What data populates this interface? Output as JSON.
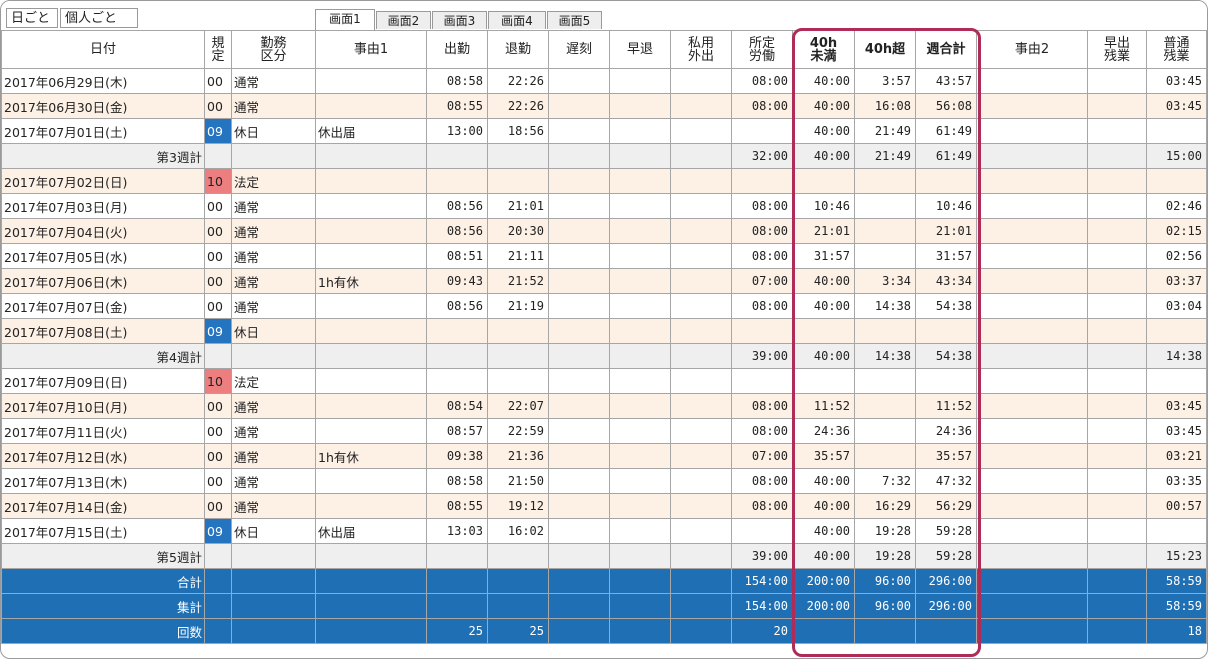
{
  "mode_tabs": [
    "日ごと",
    "個人ごと"
  ],
  "screen_tabs": [
    "画面1",
    "画面2",
    "画面3",
    "画面4",
    "画面5"
  ],
  "columns": [
    {
      "label": [
        "日付"
      ]
    },
    {
      "label": [
        "規",
        "定"
      ]
    },
    {
      "label": [
        "勤務",
        "区分"
      ]
    },
    {
      "label": [
        "事由1"
      ]
    },
    {
      "label": [
        "出勤"
      ]
    },
    {
      "label": [
        "退勤"
      ]
    },
    {
      "label": [
        "遅刻"
      ]
    },
    {
      "label": [
        "早退"
      ]
    },
    {
      "label": [
        "私用",
        "外出"
      ]
    },
    {
      "label": [
        "所定",
        "労働"
      ]
    },
    {
      "label": [
        "40h",
        "未満"
      ],
      "bold": true
    },
    {
      "label": [
        "40h超"
      ],
      "bold": true
    },
    {
      "label": [
        "週合計"
      ],
      "bold": true
    },
    {
      "label": [
        "事由2"
      ]
    },
    {
      "label": [
        "早出",
        "残業"
      ]
    },
    {
      "label": [
        "普通",
        "残業"
      ]
    }
  ],
  "rows": [
    {
      "kind": "day",
      "date": "2017年06月29日(木)",
      "code": "00",
      "type": "通常",
      "reason1": "",
      "in": "08:58",
      "out": "22:26",
      "late": "",
      "early": "",
      "private": "",
      "sched": "08:00",
      "u40": "40:00",
      "o40": "3:57",
      "week": "43:57",
      "reason2": "",
      "hayade": "",
      "ot": "03:45"
    },
    {
      "kind": "day",
      "date": "2017年06月30日(金)",
      "code": "00",
      "type": "通常",
      "reason1": "",
      "in": "08:55",
      "out": "22:26",
      "late": "",
      "early": "",
      "private": "",
      "sched": "08:00",
      "u40": "40:00",
      "o40": "16:08",
      "week": "56:08",
      "reason2": "",
      "hayade": "",
      "ot": "03:45"
    },
    {
      "kind": "day",
      "date": "2017年07月01日(土)",
      "code": "09",
      "type": "休日",
      "reason1": "休出届",
      "in": "13:00",
      "out": "18:56",
      "late": "",
      "early": "",
      "private": "",
      "sched": "",
      "u40": "40:00",
      "o40": "21:49",
      "week": "61:49",
      "reason2": "",
      "hayade": "",
      "ot": ""
    },
    {
      "kind": "week",
      "label": "第3週計",
      "sched": "32:00",
      "u40": "40:00",
      "o40": "21:49",
      "week": "61:49",
      "hayade": "",
      "ot": "15:00"
    },
    {
      "kind": "day",
      "date": "2017年07月02日(日)",
      "code": "10",
      "type": "法定",
      "reason1": "",
      "in": "",
      "out": "",
      "late": "",
      "early": "",
      "private": "",
      "sched": "",
      "u40": "",
      "o40": "",
      "week": "",
      "reason2": "",
      "hayade": "",
      "ot": ""
    },
    {
      "kind": "day",
      "date": "2017年07月03日(月)",
      "code": "00",
      "type": "通常",
      "reason1": "",
      "in": "08:56",
      "out": "21:01",
      "late": "",
      "early": "",
      "private": "",
      "sched": "08:00",
      "u40": "10:46",
      "o40": "",
      "week": "10:46",
      "reason2": "",
      "hayade": "",
      "ot": "02:46"
    },
    {
      "kind": "day",
      "date": "2017年07月04日(火)",
      "code": "00",
      "type": "通常",
      "reason1": "",
      "in": "08:56",
      "out": "20:30",
      "late": "",
      "early": "",
      "private": "",
      "sched": "08:00",
      "u40": "21:01",
      "o40": "",
      "week": "21:01",
      "reason2": "",
      "hayade": "",
      "ot": "02:15"
    },
    {
      "kind": "day",
      "date": "2017年07月05日(水)",
      "code": "00",
      "type": "通常",
      "reason1": "",
      "in": "08:51",
      "out": "21:11",
      "late": "",
      "early": "",
      "private": "",
      "sched": "08:00",
      "u40": "31:57",
      "o40": "",
      "week": "31:57",
      "reason2": "",
      "hayade": "",
      "ot": "02:56"
    },
    {
      "kind": "day",
      "date": "2017年07月06日(木)",
      "code": "00",
      "type": "通常",
      "reason1": "1h有休",
      "in": "09:43",
      "out": "21:52",
      "late": "",
      "early": "",
      "private": "",
      "sched": "07:00",
      "u40": "40:00",
      "o40": "3:34",
      "week": "43:34",
      "reason2": "",
      "hayade": "",
      "ot": "03:37"
    },
    {
      "kind": "day",
      "date": "2017年07月07日(金)",
      "code": "00",
      "type": "通常",
      "reason1": "",
      "in": "08:56",
      "out": "21:19",
      "late": "",
      "early": "",
      "private": "",
      "sched": "08:00",
      "u40": "40:00",
      "o40": "14:38",
      "week": "54:38",
      "reason2": "",
      "hayade": "",
      "ot": "03:04"
    },
    {
      "kind": "day",
      "date": "2017年07月08日(土)",
      "code": "09",
      "type": "休日",
      "reason1": "",
      "in": "",
      "out": "",
      "late": "",
      "early": "",
      "private": "",
      "sched": "",
      "u40": "",
      "o40": "",
      "week": "",
      "reason2": "",
      "hayade": "",
      "ot": ""
    },
    {
      "kind": "week",
      "label": "第4週計",
      "sched": "39:00",
      "u40": "40:00",
      "o40": "14:38",
      "week": "54:38",
      "hayade": "",
      "ot": "14:38"
    },
    {
      "kind": "day",
      "date": "2017年07月09日(日)",
      "code": "10",
      "type": "法定",
      "reason1": "",
      "in": "",
      "out": "",
      "late": "",
      "early": "",
      "private": "",
      "sched": "",
      "u40": "",
      "o40": "",
      "week": "",
      "reason2": "",
      "hayade": "",
      "ot": ""
    },
    {
      "kind": "day",
      "date": "2017年07月10日(月)",
      "code": "00",
      "type": "通常",
      "reason1": "",
      "in": "08:54",
      "out": "22:07",
      "late": "",
      "early": "",
      "private": "",
      "sched": "08:00",
      "u40": "11:52",
      "o40": "",
      "week": "11:52",
      "reason2": "",
      "hayade": "",
      "ot": "03:45"
    },
    {
      "kind": "day",
      "date": "2017年07月11日(火)",
      "code": "00",
      "type": "通常",
      "reason1": "",
      "in": "08:57",
      "out": "22:59",
      "late": "",
      "early": "",
      "private": "",
      "sched": "08:00",
      "u40": "24:36",
      "o40": "",
      "week": "24:36",
      "reason2": "",
      "hayade": "",
      "ot": "03:45"
    },
    {
      "kind": "day",
      "date": "2017年07月12日(水)",
      "code": "00",
      "type": "通常",
      "reason1": "1h有休",
      "in": "09:38",
      "out": "21:36",
      "late": "",
      "early": "",
      "private": "",
      "sched": "07:00",
      "u40": "35:57",
      "o40": "",
      "week": "35:57",
      "reason2": "",
      "hayade": "",
      "ot": "03:21"
    },
    {
      "kind": "day",
      "date": "2017年07月13日(木)",
      "code": "00",
      "type": "通常",
      "reason1": "",
      "in": "08:58",
      "out": "21:50",
      "late": "",
      "early": "",
      "private": "",
      "sched": "08:00",
      "u40": "40:00",
      "o40": "7:32",
      "week": "47:32",
      "reason2": "",
      "hayade": "",
      "ot": "03:35"
    },
    {
      "kind": "day",
      "date": "2017年07月14日(金)",
      "code": "00",
      "type": "通常",
      "reason1": "",
      "in": "08:55",
      "out": "19:12",
      "late": "",
      "early": "",
      "private": "",
      "sched": "08:00",
      "u40": "40:00",
      "o40": "16:29",
      "week": "56:29",
      "reason2": "",
      "hayade": "",
      "ot": "00:57"
    },
    {
      "kind": "day",
      "date": "2017年07月15日(土)",
      "code": "09",
      "type": "休日",
      "reason1": "休出届",
      "in": "13:03",
      "out": "16:02",
      "late": "",
      "early": "",
      "private": "",
      "sched": "",
      "u40": "40:00",
      "o40": "19:28",
      "week": "59:28",
      "reason2": "",
      "hayade": "",
      "ot": ""
    },
    {
      "kind": "week",
      "label": "第5週計",
      "sched": "39:00",
      "u40": "40:00",
      "o40": "19:28",
      "week": "59:28",
      "hayade": "",
      "ot": "15:23"
    },
    {
      "kind": "total",
      "label": "合計",
      "in": "",
      "out": "",
      "sched": "154:00",
      "u40": "200:00",
      "o40": "96:00",
      "week": "296:00",
      "hayade": "",
      "ot": "58:59"
    },
    {
      "kind": "total",
      "label": "集計",
      "in": "",
      "out": "",
      "sched": "154:00",
      "u40": "200:00",
      "o40": "96:00",
      "week": "296:00",
      "hayade": "",
      "ot": "58:59"
    },
    {
      "kind": "total",
      "label": "回数",
      "in": "25",
      "out": "25",
      "sched": "20",
      "u40": "",
      "o40": "",
      "week": "",
      "hayade": "",
      "ot": "18"
    }
  ],
  "colors": {
    "accent_blue": "#1f6fb5",
    "holiday_code_blue": "#2474c0",
    "legal_holiday_code_red": "#ec7e80",
    "alt_row": "#fdf0e5",
    "week_row": "#efefef",
    "highlight_frame": "#b02c58"
  }
}
